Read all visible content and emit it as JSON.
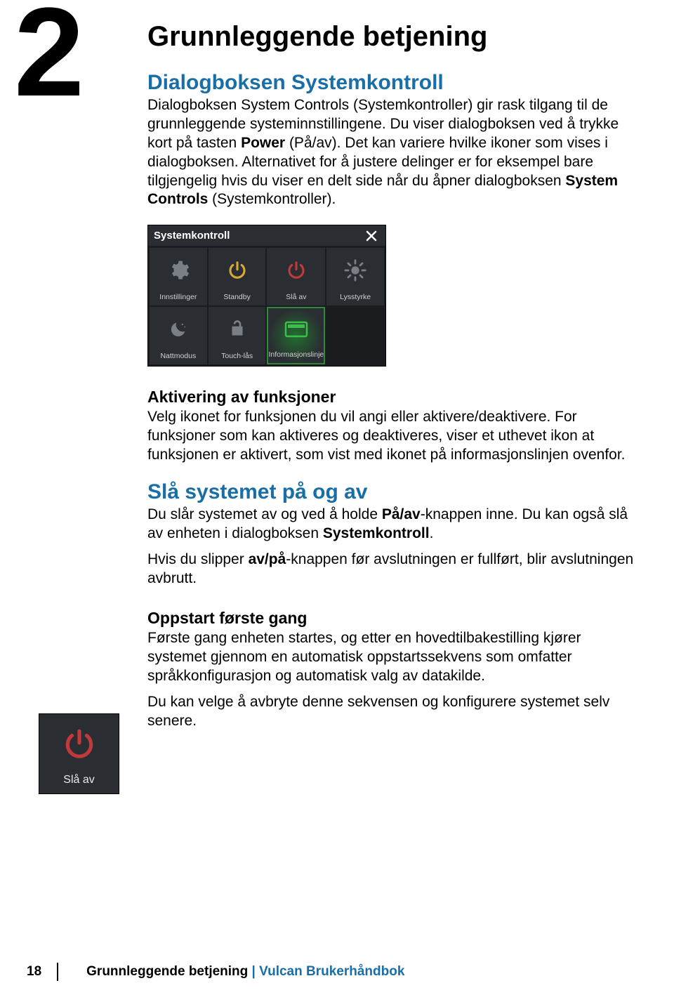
{
  "chapter_number": "2",
  "title": "Grunnleggende betjening",
  "section1": {
    "heading": "Dialogboksen Systemkontroll",
    "p1a": "Dialogboksen System Controls (Systemkontroller) gir rask tilgang til de grunnleggende systeminnstillingene. Du viser dialogboksen ved å trykke kort på tasten ",
    "p1b": "Power",
    "p1c": " (På/av). Det kan variere hvilke ikoner som vises i dialogboksen. Alternativet for å justere delinger er for eksempel bare tilgjengelig hvis du viser en delt side når du åpner dialogboksen ",
    "p1d": "System Controls",
    "p1e": " (Systemkontroller)."
  },
  "dialog": {
    "title": "Systemkontroll",
    "cells": [
      {
        "label": "Innstillinger",
        "icon": "gear"
      },
      {
        "label": "Standby",
        "icon": "power-yellow"
      },
      {
        "label": "Slå av",
        "icon": "power-red"
      },
      {
        "label": "Lysstyrke",
        "icon": "brightness"
      },
      {
        "label": "Nattmodus",
        "icon": "moon"
      },
      {
        "label": "Touch-lås",
        "icon": "lock-open"
      },
      {
        "label": "Informasjonslinje",
        "icon": "info-bar",
        "highlight": true
      }
    ]
  },
  "section2": {
    "heading": "Aktivering av funksjoner",
    "p": "Velg ikonet for funksjonen du vil angi eller aktivere/deaktivere. For funksjoner som kan aktiveres og deaktiveres, viser et uthevet ikon at funksjonen er aktivert, som vist med ikonet på informasjonslinjen ovenfor."
  },
  "section3": {
    "heading": "Slå systemet på og av",
    "p1a": "Du slår systemet av og ved å holde ",
    "p1b": "På/av",
    "p1c": "-knappen inne. Du kan også slå av enheten i dialogboksen ",
    "p1d": "Systemkontroll",
    "p1e": ".",
    "p2a": "Hvis du slipper ",
    "p2b": "av/på",
    "p2c": "-knappen før avslutningen er fullført, blir avslutningen avbrutt."
  },
  "side_tile": {
    "label": "Slå av"
  },
  "section4": {
    "heading": "Oppstart første gang",
    "p1": "Første gang enheten startes, og etter en hovedtilbakestilling kjører systemet gjennom en automatisk oppstartssekvens som omfatter språkkonfigurasjon og automatisk valg av datakilde.",
    "p2": "Du kan velge å avbryte denne sekvensen og konfigurere systemet selv senere."
  },
  "footer": {
    "page": "18",
    "chapter": "Grunnleggende betjening",
    "sep": " | ",
    "book": "Vulcan Brukerhåndbok"
  }
}
